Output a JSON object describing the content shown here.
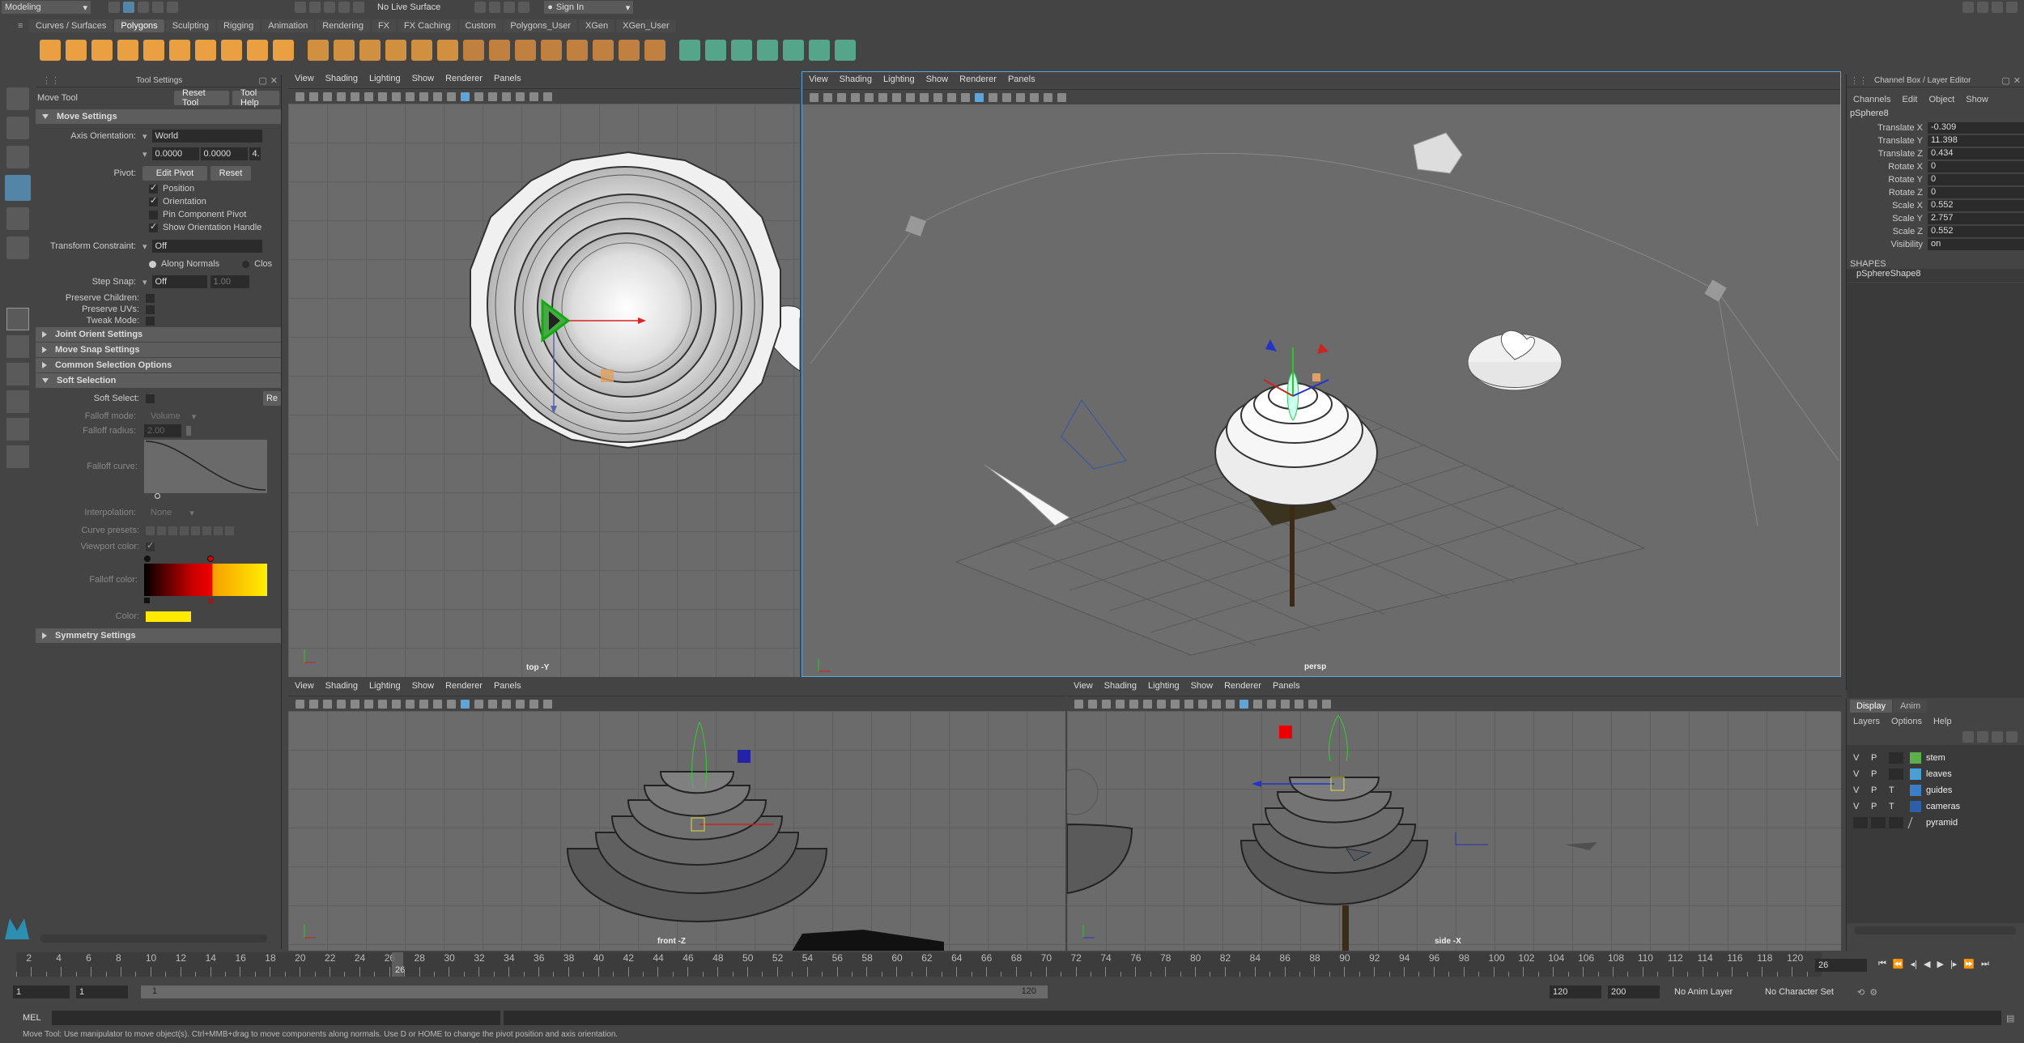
{
  "topbar": {
    "workspace": "Modeling",
    "live_surface": "No Live Surface",
    "sign_in": "Sign In"
  },
  "shelf_tabs": [
    "Curves / Surfaces",
    "Polygons",
    "Sculpting",
    "Rigging",
    "Animation",
    "Rendering",
    "FX",
    "FX Caching",
    "Custom",
    "Polygons_User",
    "XGen",
    "XGen_User"
  ],
  "active_shelf": "Polygons",
  "tool_settings": {
    "panel_title": "Tool Settings",
    "tool_name": "Move Tool",
    "reset_tool": "Reset Tool",
    "tool_help": "Tool Help",
    "move_settings": "Move Settings",
    "axis_orientation_label": "Axis Orientation:",
    "axis_orientation_value": "World",
    "xyz": [
      "0.0000",
      "0.0000",
      "4."
    ],
    "pivot_label": "Pivot:",
    "edit_pivot": "Edit Pivot",
    "reset": "Reset",
    "checks": [
      {
        "label": "Position",
        "on": true
      },
      {
        "label": "Orientation",
        "on": true
      },
      {
        "label": "Pin Component Pivot",
        "on": false
      },
      {
        "label": "Show Orientation Handle",
        "on": true
      }
    ],
    "transform_constraint_label": "Transform Constraint:",
    "transform_constraint_value": "Off",
    "along_normals": "Along Normals",
    "clos": "Clos",
    "step_snap_label": "Step Snap:",
    "step_snap_value": "Off",
    "step_snap_num": "1.00",
    "preserve_children": "Preserve Children:",
    "preserve_uvs": "Preserve UVs:",
    "tweak_mode": "Tweak Mode:",
    "joint_orient": "Joint Orient Settings",
    "move_snap": "Move Snap Settings",
    "common_selection": "Common Selection Options",
    "soft_selection": "Soft Selection",
    "soft_select_label": "Soft Select:",
    "re": "Re",
    "falloff_mode_label": "Falloff mode:",
    "falloff_mode_value": "Volume",
    "falloff_radius_label": "Falloff radius:",
    "falloff_radius_value": "2.00",
    "falloff_curve_label": "Falloff curve:",
    "interpolation_label": "Interpolation:",
    "interpolation_value": "None",
    "curve_presets_label": "Curve presets:",
    "viewport_color_label": "Viewport color:",
    "falloff_color_label": "Falloff color:",
    "color_label": "Color:",
    "symmetry": "Symmetry Settings"
  },
  "viewport_menu": [
    "View",
    "Shading",
    "Lighting",
    "Show",
    "Renderer",
    "Panels"
  ],
  "viewports": {
    "top": "top -Y",
    "persp": "persp",
    "front": "front -Z",
    "side": "side -X"
  },
  "channel_box": {
    "title": "Channel Box / Layer Editor",
    "menus": [
      "Channels",
      "Edit",
      "Object",
      "Show"
    ],
    "object": "pSphere8",
    "channels": [
      {
        "name": "Translate X",
        "value": "-0.309"
      },
      {
        "name": "Translate Y",
        "value": "11.398"
      },
      {
        "name": "Translate Z",
        "value": "0.434"
      },
      {
        "name": "Rotate X",
        "value": "0"
      },
      {
        "name": "Rotate Y",
        "value": "0"
      },
      {
        "name": "Rotate Z",
        "value": "0"
      },
      {
        "name": "Scale X",
        "value": "0.552"
      },
      {
        "name": "Scale Y",
        "value": "2.757"
      },
      {
        "name": "Scale Z",
        "value": "0.552"
      },
      {
        "name": "Visibility",
        "value": "on"
      }
    ],
    "shapes_label": "SHAPES",
    "shape": "pSphereShape8"
  },
  "layer_editor": {
    "tabs": [
      "Display",
      "Anim"
    ],
    "menus": [
      "Layers",
      "Options",
      "Help"
    ],
    "layers": [
      {
        "v": "V",
        "p": "P",
        "t": "",
        "name": "stem",
        "color": "#5cb04a"
      },
      {
        "v": "V",
        "p": "P",
        "t": "",
        "name": "leaves",
        "color": "#4a9fd8"
      },
      {
        "v": "V",
        "p": "P",
        "t": "T",
        "name": "guides",
        "color": "#3a7ec8"
      },
      {
        "v": "V",
        "p": "P",
        "t": "T",
        "name": "cameras",
        "color": "#2c5fa8"
      },
      {
        "v": "",
        "p": "",
        "t": "",
        "name": "pyramid",
        "color": ""
      }
    ]
  },
  "timeline": {
    "ticks": [
      "2",
      "4",
      "6",
      "8",
      "10",
      "12",
      "14",
      "16",
      "18",
      "20",
      "22",
      "24",
      "26",
      "28",
      "30",
      "32",
      "34",
      "36",
      "38",
      "40",
      "42",
      "44",
      "46",
      "48",
      "50",
      "52",
      "54",
      "56",
      "58",
      "60",
      "62",
      "64",
      "66",
      "68",
      "70",
      "72",
      "74",
      "76",
      "78",
      "80",
      "82",
      "84",
      "86",
      "88",
      "90",
      "92",
      "94",
      "96",
      "98",
      "100",
      "102",
      "104",
      "106",
      "108",
      "110",
      "112",
      "114",
      "116",
      "118",
      "120"
    ],
    "current_frame": "26",
    "current_marker": "26"
  },
  "range": {
    "start": "1",
    "start2": "1",
    "slider_start": "1",
    "slider_end": "120",
    "end": "120",
    "end2": "200",
    "anim_layer": "No Anim Layer",
    "char_set": "No Character Set"
  },
  "command": {
    "lang": "MEL"
  },
  "help_line": "Move Tool: Use manipulator to move object(s). Ctrl+MMB+drag to move components along normals. Use D or HOME to change the pivot position and axis orientation."
}
